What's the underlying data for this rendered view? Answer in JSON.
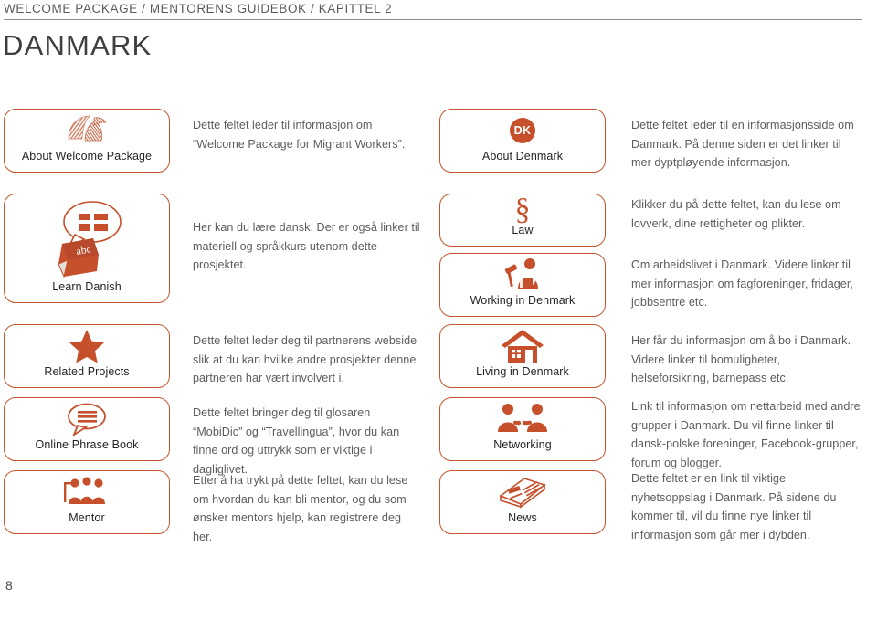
{
  "header": {
    "breadcrumb": "WELCOME PACKAGE / MENTORENS GUIDEBOK / KAPITTEL 2",
    "title": "DANMARK"
  },
  "page_number": "8",
  "colors": {
    "accent": "#c5502b",
    "border": "#c5552e",
    "body_text": "#5d5d5d",
    "label_text": "#262626",
    "breadcrumb_text": "#5b5b5b",
    "rule": "#8d8d8d"
  },
  "left_column": [
    {
      "label": "About Welcome Package",
      "icon": "welcome-package-logo-icon",
      "description": "Dette feltet leder til informasjon om “Welcome Package for Migrant Workers”."
    },
    {
      "label": "Learn Danish",
      "icon": "abc-book-speech-bubble-icon",
      "description": "Her kan du lære dansk. Der er også linker til materiell og språkkurs utenom dette prosjektet."
    },
    {
      "label": "Related Projects",
      "icon": "star-icon",
      "description": "Dette feltet leder deg til partnerens webside slik at du kan hvilke andre prosjekter denne partneren har vært involvert i."
    },
    {
      "label": "Online Phrase Book",
      "icon": "speech-bubble-lines-icon",
      "description": "Dette feltet bringer deg til glosaren “MobiDic” og “Travellingua”, hvor du kan finne ord og uttrykk som er viktige i dagliglivet."
    },
    {
      "label": "Mentor",
      "icon": "mentor-people-icon",
      "description": "Etter å ha trykt på dette feltet, kan du lese om hvordan du kan bli mentor, og du som ønsker mentors hjelp, kan registrere deg her."
    }
  ],
  "right_column": [
    {
      "label": "About Denmark",
      "icon": "dk-badge-icon",
      "icon_text": "DK",
      "description": "Dette feltet leder til en informasjonsside om Danmark. På denne siden er det linker til mer dyptpløyende informasjon."
    },
    {
      "label": "Law",
      "icon": "section-sign-icon",
      "icon_text": "§",
      "description": "Klikker du på dette feltet, kan du lese om lovverk, dine rettigheter og plikter."
    },
    {
      "label": "Working in Denmark",
      "icon": "worker-hammer-icon",
      "description": "Om arbeidslivet i Danmark. Videre linker til mer informasjon om fagforeninger, fridager, jobbsentre etc."
    },
    {
      "label": "Living in Denmark",
      "icon": "house-icon",
      "description": "Her får du informasjon om å bo i Danmark. Videre linker til bomuligheter, helseforsikring, barnepass etc."
    },
    {
      "label": "Networking",
      "icon": "two-people-handshake-icon",
      "description": "Link til informasjon om nettarbeid med andre grupper i Danmark. Du vil finne linker til dansk-polske foreninger, Facebook-grupper, forum og blogger."
    },
    {
      "label": "News",
      "icon": "newspaper-icon",
      "description": "Dette feltet er en link til viktige nyhetsoppslag i Danmark. På sidene du kommer til, vil du finne nye linker til informasjon som går mer i dybden."
    }
  ]
}
